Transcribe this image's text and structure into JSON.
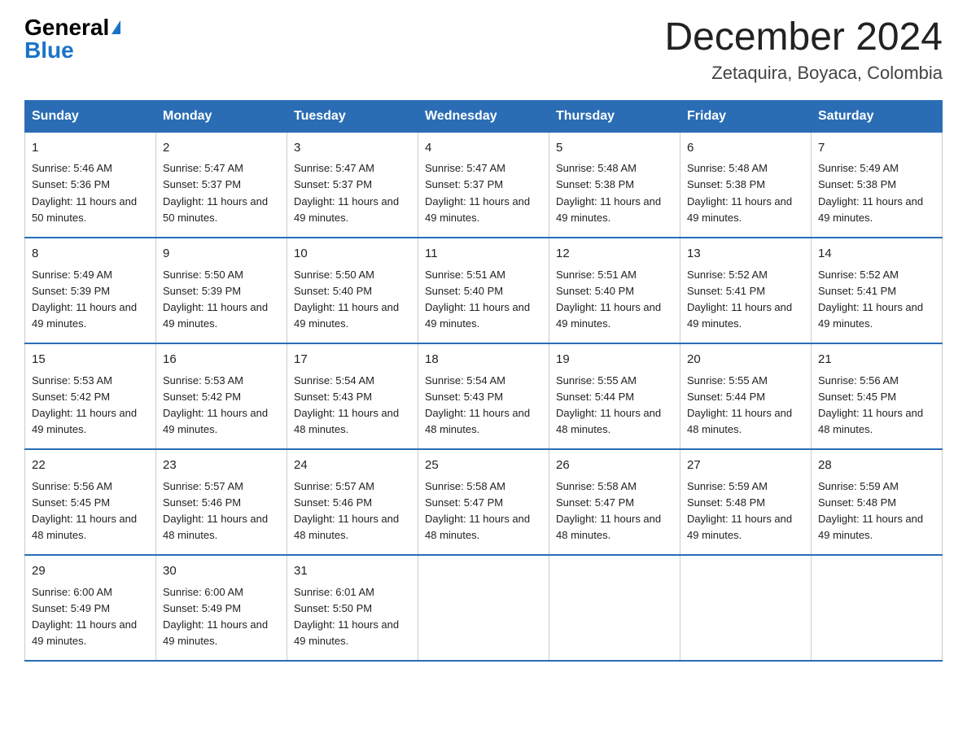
{
  "logo": {
    "general": "General",
    "blue": "Blue",
    "triangle": "▶"
  },
  "title": "December 2024",
  "location": "Zetaquira, Boyaca, Colombia",
  "days_of_week": [
    "Sunday",
    "Monday",
    "Tuesday",
    "Wednesday",
    "Thursday",
    "Friday",
    "Saturday"
  ],
  "weeks": [
    [
      {
        "day": "1",
        "sunrise": "5:46 AM",
        "sunset": "5:36 PM",
        "daylight": "11 hours and 50 minutes."
      },
      {
        "day": "2",
        "sunrise": "5:47 AM",
        "sunset": "5:37 PM",
        "daylight": "11 hours and 50 minutes."
      },
      {
        "day": "3",
        "sunrise": "5:47 AM",
        "sunset": "5:37 PM",
        "daylight": "11 hours and 49 minutes."
      },
      {
        "day": "4",
        "sunrise": "5:47 AM",
        "sunset": "5:37 PM",
        "daylight": "11 hours and 49 minutes."
      },
      {
        "day": "5",
        "sunrise": "5:48 AM",
        "sunset": "5:38 PM",
        "daylight": "11 hours and 49 minutes."
      },
      {
        "day": "6",
        "sunrise": "5:48 AM",
        "sunset": "5:38 PM",
        "daylight": "11 hours and 49 minutes."
      },
      {
        "day": "7",
        "sunrise": "5:49 AM",
        "sunset": "5:38 PM",
        "daylight": "11 hours and 49 minutes."
      }
    ],
    [
      {
        "day": "8",
        "sunrise": "5:49 AM",
        "sunset": "5:39 PM",
        "daylight": "11 hours and 49 minutes."
      },
      {
        "day": "9",
        "sunrise": "5:50 AM",
        "sunset": "5:39 PM",
        "daylight": "11 hours and 49 minutes."
      },
      {
        "day": "10",
        "sunrise": "5:50 AM",
        "sunset": "5:40 PM",
        "daylight": "11 hours and 49 minutes."
      },
      {
        "day": "11",
        "sunrise": "5:51 AM",
        "sunset": "5:40 PM",
        "daylight": "11 hours and 49 minutes."
      },
      {
        "day": "12",
        "sunrise": "5:51 AM",
        "sunset": "5:40 PM",
        "daylight": "11 hours and 49 minutes."
      },
      {
        "day": "13",
        "sunrise": "5:52 AM",
        "sunset": "5:41 PM",
        "daylight": "11 hours and 49 minutes."
      },
      {
        "day": "14",
        "sunrise": "5:52 AM",
        "sunset": "5:41 PM",
        "daylight": "11 hours and 49 minutes."
      }
    ],
    [
      {
        "day": "15",
        "sunrise": "5:53 AM",
        "sunset": "5:42 PM",
        "daylight": "11 hours and 49 minutes."
      },
      {
        "day": "16",
        "sunrise": "5:53 AM",
        "sunset": "5:42 PM",
        "daylight": "11 hours and 49 minutes."
      },
      {
        "day": "17",
        "sunrise": "5:54 AM",
        "sunset": "5:43 PM",
        "daylight": "11 hours and 48 minutes."
      },
      {
        "day": "18",
        "sunrise": "5:54 AM",
        "sunset": "5:43 PM",
        "daylight": "11 hours and 48 minutes."
      },
      {
        "day": "19",
        "sunrise": "5:55 AM",
        "sunset": "5:44 PM",
        "daylight": "11 hours and 48 minutes."
      },
      {
        "day": "20",
        "sunrise": "5:55 AM",
        "sunset": "5:44 PM",
        "daylight": "11 hours and 48 minutes."
      },
      {
        "day": "21",
        "sunrise": "5:56 AM",
        "sunset": "5:45 PM",
        "daylight": "11 hours and 48 minutes."
      }
    ],
    [
      {
        "day": "22",
        "sunrise": "5:56 AM",
        "sunset": "5:45 PM",
        "daylight": "11 hours and 48 minutes."
      },
      {
        "day": "23",
        "sunrise": "5:57 AM",
        "sunset": "5:46 PM",
        "daylight": "11 hours and 48 minutes."
      },
      {
        "day": "24",
        "sunrise": "5:57 AM",
        "sunset": "5:46 PM",
        "daylight": "11 hours and 48 minutes."
      },
      {
        "day": "25",
        "sunrise": "5:58 AM",
        "sunset": "5:47 PM",
        "daylight": "11 hours and 48 minutes."
      },
      {
        "day": "26",
        "sunrise": "5:58 AM",
        "sunset": "5:47 PM",
        "daylight": "11 hours and 48 minutes."
      },
      {
        "day": "27",
        "sunrise": "5:59 AM",
        "sunset": "5:48 PM",
        "daylight": "11 hours and 49 minutes."
      },
      {
        "day": "28",
        "sunrise": "5:59 AM",
        "sunset": "5:48 PM",
        "daylight": "11 hours and 49 minutes."
      }
    ],
    [
      {
        "day": "29",
        "sunrise": "6:00 AM",
        "sunset": "5:49 PM",
        "daylight": "11 hours and 49 minutes."
      },
      {
        "day": "30",
        "sunrise": "6:00 AM",
        "sunset": "5:49 PM",
        "daylight": "11 hours and 49 minutes."
      },
      {
        "day": "31",
        "sunrise": "6:01 AM",
        "sunset": "5:50 PM",
        "daylight": "11 hours and 49 minutes."
      },
      null,
      null,
      null,
      null
    ]
  ],
  "colors": {
    "header_bg": "#2a6db5",
    "header_text": "#ffffff",
    "border": "#2a6db5",
    "body_border": "#cccccc"
  }
}
